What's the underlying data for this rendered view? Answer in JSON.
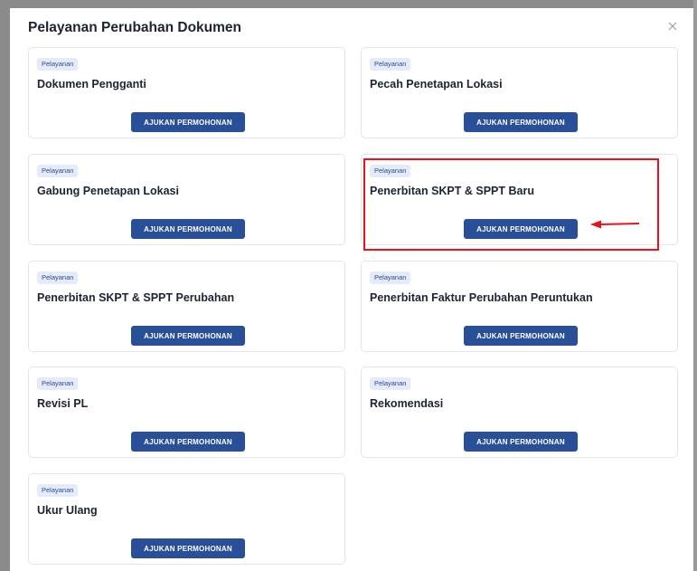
{
  "modal": {
    "title": "Pelayanan Perubahan Dokumen",
    "close_icon": "close-x-icon"
  },
  "cards": [
    {
      "badge": "Pelayanan",
      "title": "Dokumen Pengganti",
      "button": "AJUKAN PERMOHONAN"
    },
    {
      "badge": "Pelayanan",
      "title": "Pecah Penetapan Lokasi",
      "button": "AJUKAN PERMOHONAN"
    },
    {
      "badge": "Pelayanan",
      "title": "Gabung Penetapan Lokasi",
      "button": "AJUKAN PERMOHONAN"
    },
    {
      "badge": "Pelayanan",
      "title": "Penerbitan SKPT & SPPT Baru",
      "button": "AJUKAN PERMOHONAN"
    },
    {
      "badge": "Pelayanan",
      "title": "Penerbitan SKPT & SPPT Perubahan",
      "button": "AJUKAN PERMOHONAN"
    },
    {
      "badge": "Pelayanan",
      "title": "Penerbitan Faktur Perubahan Peruntukan",
      "button": "AJUKAN PERMOHONAN"
    },
    {
      "badge": "Pelayanan",
      "title": "Revisi PL",
      "button": "AJUKAN PERMOHONAN"
    },
    {
      "badge": "Pelayanan",
      "title": "Rekomendasi",
      "button": "AJUKAN PERMOHONAN"
    },
    {
      "badge": "Pelayanan",
      "title": "Ukur Ulang",
      "button": "AJUKAN PERMOHONAN"
    }
  ],
  "annotation": {
    "highlight_color": "#e8141b",
    "arrow_icon": "red-arrow-left-icon"
  },
  "colors": {
    "button_bg": "#284f98",
    "badge_bg": "#e5ebf8",
    "badge_text": "#284c93",
    "title_text": "#1c2333",
    "card_border": "#e2e5ea"
  }
}
